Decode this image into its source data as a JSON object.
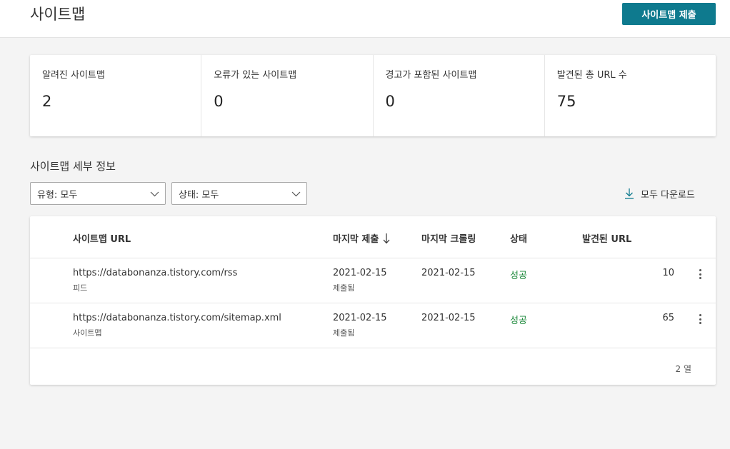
{
  "header": {
    "title": "사이트맵",
    "submit_button": "사이트맵 제출"
  },
  "stats": [
    {
      "label": "알려진 사이트맵",
      "value": "2"
    },
    {
      "label": "오류가 있는 사이트맵",
      "value": "0"
    },
    {
      "label": "경고가 포함된 사이트맵",
      "value": "0"
    },
    {
      "label": "발견된 총 URL 수",
      "value": "75"
    }
  ],
  "details": {
    "title": "사이트맵 세부 정보",
    "filter_type": "유형: 모두",
    "filter_status": "상태: 모두",
    "download_all": "모두 다운로드"
  },
  "table": {
    "columns": {
      "url": "사이트맵 URL",
      "last_submitted": "마지막 제출",
      "last_crawled": "마지막 크롤링",
      "status": "상태",
      "found_urls": "발견된 URL"
    },
    "rows": [
      {
        "url": "https://databonanza.tistory.com/rss",
        "type": "피드",
        "submitted": "2021-02-15",
        "submitted_note": "제출됨",
        "crawled": "2021-02-15",
        "status": "성공",
        "found": "10"
      },
      {
        "url": "https://databonanza.tistory.com/sitemap.xml",
        "type": "사이트맵",
        "submitted": "2021-02-15",
        "submitted_note": "제출됨",
        "crawled": "2021-02-15",
        "status": "성공",
        "found": "65"
      }
    ],
    "row_count": "2 열"
  },
  "colors": {
    "accent": "#0e7a8e",
    "success": "#1e8a3c"
  },
  "icons": {
    "sort": "arrow-down-icon",
    "download": "download-icon",
    "dropdown": "chevron-down-icon",
    "row_menu": "more-vertical-icon"
  }
}
